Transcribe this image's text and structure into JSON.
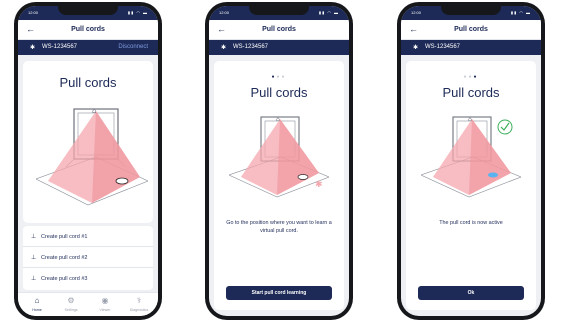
{
  "status_time": "12:00",
  "status_icons": "▮▮ ◠ ▬",
  "header": {
    "back_symbol": "←",
    "title": "Pull cords"
  },
  "device": {
    "bt_symbol": "✱",
    "name": "WS-1234567",
    "disconnect_label": "Disconnect"
  },
  "screen1": {
    "card_title": "Pull cords",
    "items": [
      {
        "symbol": "⊥",
        "label": "Create pull cord #1"
      },
      {
        "symbol": "⊥",
        "label": "Create pull cord #2"
      },
      {
        "symbol": "⊥",
        "label": "Create pull cord #3"
      }
    ],
    "tabs": [
      {
        "symbol": "⌂",
        "label": "Home"
      },
      {
        "symbol": "⚙",
        "label": "Settings"
      },
      {
        "symbol": "◉",
        "label": "Viewer"
      },
      {
        "symbol": "⚕",
        "label": "Diagnostics"
      }
    ]
  },
  "screen2": {
    "card_title": "Pull cords",
    "text": "Go to the position where you want to learn a virtual pull cord.",
    "button_label": "Start pull cord learning"
  },
  "screen3": {
    "card_title": "Pull cords",
    "text": "The pull cord is now active",
    "button_label": "Ok"
  },
  "colors": {
    "navy": "#1d2a57",
    "cone": "#f4a7ad",
    "check": "#3cae5a",
    "cord_active": "#5ab3f0"
  }
}
